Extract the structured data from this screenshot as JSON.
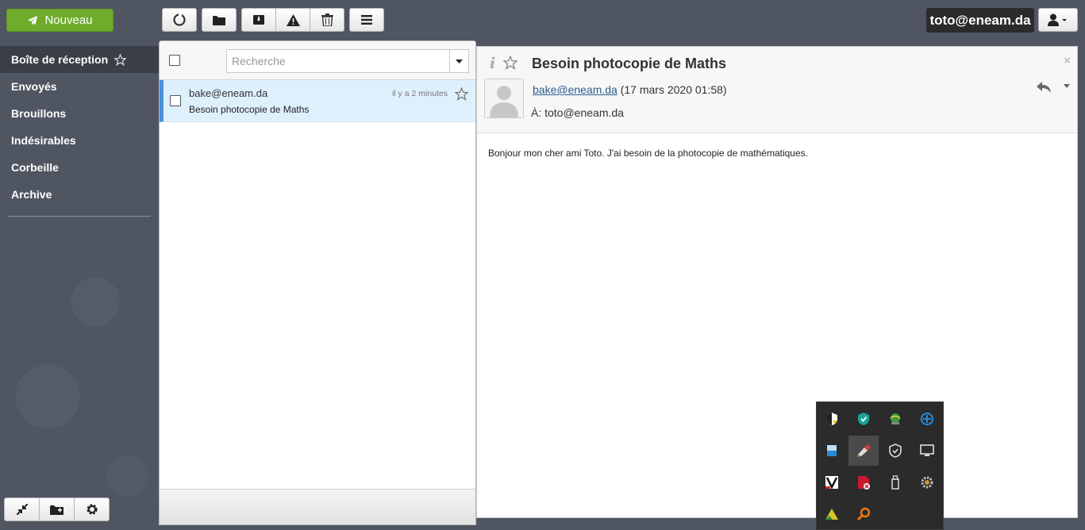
{
  "toolbar": {
    "new_label": "Nouveau"
  },
  "account": {
    "email": "toto@eneam.da"
  },
  "sidebar": {
    "folders": [
      {
        "label": "Boîte de réception"
      },
      {
        "label": "Envoyés"
      },
      {
        "label": "Brouillons"
      },
      {
        "label": "Indésirables"
      },
      {
        "label": "Corbeille"
      },
      {
        "label": "Archive"
      }
    ]
  },
  "list": {
    "search_placeholder": "Recherche",
    "messages": [
      {
        "from": "bake@eneam.da",
        "subject": "Besoin photocopie de Maths",
        "date": "il y a 2 minutes"
      }
    ]
  },
  "reader": {
    "subject": "Besoin photocopie de Maths",
    "from": "bake@eneam.da",
    "date": "(17 mars 2020 01:58)",
    "to": "À: toto@eneam.da",
    "body": "Bonjour mon cher ami Toto. J'ai besoin de la photocopie de mathématiques.",
    "close": "×"
  },
  "colors": {
    "accent_green": "#6fac2c",
    "selected_row": "#dff0fd",
    "selected_border": "#4a90d9",
    "background": "#4f5661"
  },
  "icons": {
    "toolbar": [
      "refresh-icon",
      "folder-move-icon",
      "archive-icon",
      "spam-warning-icon",
      "trash-icon",
      "menu-icon"
    ],
    "tray": [
      "security-shield-icon",
      "antivirus-icon",
      "network-globe-icon",
      "vpn-icon",
      "storage-icon",
      "cleaner-icon",
      "defender-shield-icon",
      "monitor-icon",
      "app-icon",
      "pdf-reader-icon",
      "usb-drive-icon",
      "settings-gear-icon",
      "warning-app-icon",
      "search-tool-icon"
    ]
  }
}
